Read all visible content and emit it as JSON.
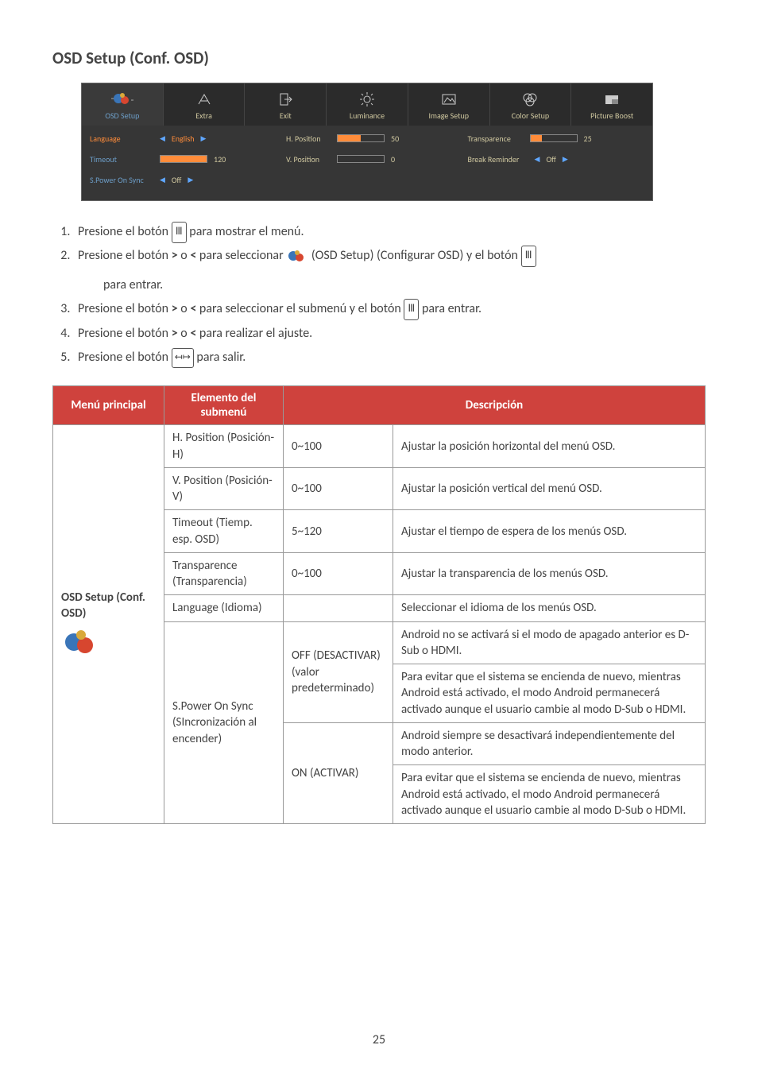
{
  "page": {
    "title": "OSD Setup (Conf. OSD)",
    "number": "25"
  },
  "osd": {
    "tabs": [
      "OSD Setup",
      "Extra",
      "Exit",
      "Luminance",
      "Image Setup",
      "Color Setup",
      "Picture Boost"
    ],
    "col1": {
      "language_label": "Language",
      "language_value": "English",
      "timeout_label": "Timeout",
      "timeout_value": "120",
      "spoweronsync_label": "S.Power On Sync",
      "spoweronsync_value": "Off"
    },
    "col2": {
      "hpos_label": "H. Position",
      "hpos_value": "50",
      "vpos_label": "V. Position",
      "vpos_value": "0"
    },
    "col3": {
      "transparence_label": "Transparence",
      "transparence_value": "25",
      "break_reminder_label": "Break Reminder",
      "break_reminder_value": "Off"
    }
  },
  "steps": {
    "s1a": "Presione el botón ",
    "s1b": " para mostrar el menú.",
    "s2a": "Presione el botón ",
    "s2b": " o ",
    "s2c": " para seleccionar ",
    "s2d": " (OSD Setup) (Configurar OSD) y el botón ",
    "s2e": "para entrar.",
    "s3a": "Presione el botón ",
    "s3b": " o ",
    "s3c": " para seleccionar el submenú y el botón ",
    "s3d": " para entrar.",
    "s4a": "Presione el botón ",
    "s4b": " o ",
    "s4c": " para realizar el ajuste.",
    "s5a": "Presione el botón ",
    "s5b": " para salir."
  },
  "table": {
    "headers": {
      "main": "Menú principal",
      "sub": "Elemento del submenú",
      "desc": "Descripción"
    },
    "main_label": "OSD Setup (Conf. OSD)",
    "rows": {
      "hpos": {
        "sub": "H. Position (Posición-H)",
        "val": "0~100",
        "desc": "Ajustar la posición horizontal del menú OSD."
      },
      "vpos": {
        "sub": "V. Position (Posición-V)",
        "val": "0~100",
        "desc": "Ajustar la posición vertical del menú OSD."
      },
      "timeout": {
        "sub": "Timeout (Tiemp. esp. OSD)",
        "val": "5~120",
        "desc": "Ajustar el tiempo de espera de los menús OSD."
      },
      "trans": {
        "sub": "Transparence (Transparencia)",
        "val": "0~100",
        "desc": "Ajustar la transparencia de los menús OSD."
      },
      "lang": {
        "sub": "Language (Idioma)",
        "val": "",
        "desc": "Seleccionar el idioma de los menús OSD."
      },
      "spower_sub": "S.Power On Sync (SIncronización al encender)",
      "off_val": "OFF (DESACTIVAR) (valor predeterminado)",
      "off_d1": "Android no se activará si el modo de apagado anterior es D-Sub o HDMI.",
      "off_d2": "Para evitar que el sistema se encienda de nuevo, mientras Android está activado, el modo Android permanecerá activado aunque el usuario cambie al modo D-Sub o HDMI.",
      "on_val": "ON (ACTIVAR)",
      "on_d1": "Android siempre se desactivará independientemente del modo anterior.",
      "on_d2": "Para evitar que el sistema se encienda de nuevo, mientras Android está activado, el modo Android permanecerá activado aunque el usuario cambie al modo D-Sub o HDMI."
    }
  }
}
